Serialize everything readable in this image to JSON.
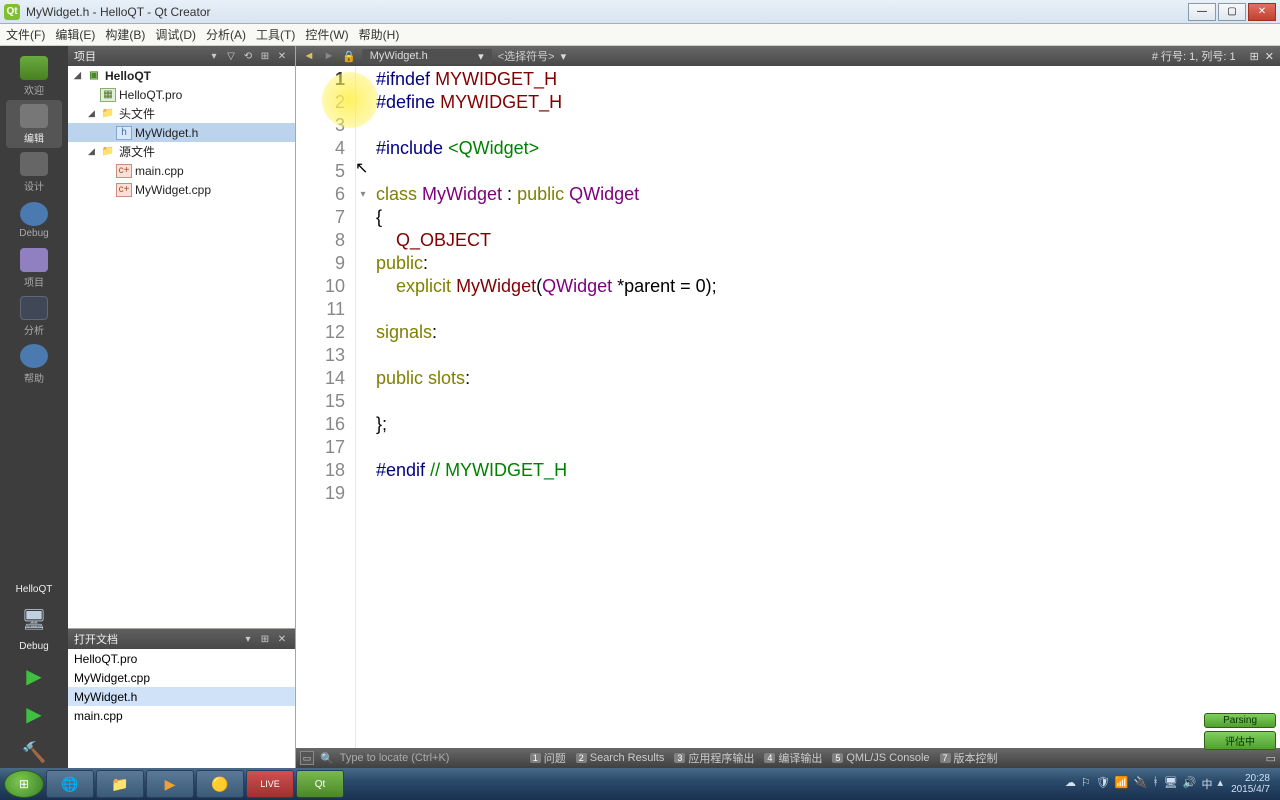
{
  "window": {
    "title": "MyWidget.h - HelloQT - Qt Creator"
  },
  "menubar": [
    "文件(F)",
    "编辑(E)",
    "构建(B)",
    "调试(D)",
    "分析(A)",
    "工具(T)",
    "控件(W)",
    "帮助(H)"
  ],
  "modes": {
    "items": [
      {
        "label": "欢迎"
      },
      {
        "label": "编辑"
      },
      {
        "label": "设计"
      },
      {
        "label": "Debug"
      },
      {
        "label": "项目"
      },
      {
        "label": "分析"
      },
      {
        "label": "帮助"
      }
    ],
    "active_index": 1,
    "kit_label": "HelloQT",
    "debug_label": "Debug"
  },
  "projects_panel": {
    "title": "项目",
    "tree": [
      {
        "label": "HelloQT",
        "kind": "project",
        "bold": true,
        "indent": 0,
        "expanded": true
      },
      {
        "label": "HelloQT.pro",
        "kind": "pro",
        "indent": 1
      },
      {
        "label": "头文件",
        "kind": "folder",
        "indent": 1,
        "expanded": true
      },
      {
        "label": "MyWidget.h",
        "kind": "h",
        "indent": 2,
        "selected": true
      },
      {
        "label": "源文件",
        "kind": "folder",
        "indent": 1,
        "expanded": true
      },
      {
        "label": "main.cpp",
        "kind": "cpp",
        "indent": 2
      },
      {
        "label": "MyWidget.cpp",
        "kind": "cpp",
        "indent": 2
      }
    ]
  },
  "open_docs_panel": {
    "title": "打开文档",
    "docs": [
      {
        "label": "HelloQT.pro"
      },
      {
        "label": "MyWidget.cpp"
      },
      {
        "label": "MyWidget.h",
        "selected": true
      },
      {
        "label": "main.cpp"
      }
    ]
  },
  "editor_toolbar": {
    "file": "MyWidget.h",
    "symbol": "<选择符号>",
    "position": "#   行号: 1, 列号: 1"
  },
  "code": {
    "lines": [
      {
        "n": 1,
        "seg": [
          [
            "pp",
            "#ifndef"
          ],
          [
            "op",
            " "
          ],
          [
            "ident",
            "MYWIDGET_H"
          ]
        ]
      },
      {
        "n": 2,
        "seg": [
          [
            "pp",
            "#define"
          ],
          [
            "op",
            " "
          ],
          [
            "ident",
            "MYWIDGET_H"
          ]
        ]
      },
      {
        "n": 3,
        "seg": []
      },
      {
        "n": 4,
        "seg": [
          [
            "pp",
            "#include"
          ],
          [
            "op",
            " "
          ],
          [
            "str",
            "<QWidget>"
          ]
        ]
      },
      {
        "n": 5,
        "seg": []
      },
      {
        "n": 6,
        "fold": "▾",
        "seg": [
          [
            "kw",
            "class"
          ],
          [
            "op",
            " "
          ],
          [
            "type",
            "MyWidget"
          ],
          [
            "op",
            " : "
          ],
          [
            "kw",
            "public"
          ],
          [
            "op",
            " "
          ],
          [
            "type",
            "QWidget"
          ]
        ]
      },
      {
        "n": 7,
        "seg": [
          [
            "op",
            "{"
          ]
        ]
      },
      {
        "n": 8,
        "seg": [
          [
            "op",
            "    "
          ],
          [
            "ident",
            "Q_OBJECT"
          ]
        ]
      },
      {
        "n": 9,
        "seg": [
          [
            "kw",
            "public"
          ],
          [
            "op",
            ":"
          ]
        ]
      },
      {
        "n": 10,
        "seg": [
          [
            "op",
            "    "
          ],
          [
            "kw",
            "explicit"
          ],
          [
            "op",
            " "
          ],
          [
            "ident",
            "MyWidget"
          ],
          [
            "op",
            "("
          ],
          [
            "type",
            "QWidget"
          ],
          [
            "op",
            " *parent = 0);"
          ]
        ]
      },
      {
        "n": 11,
        "seg": []
      },
      {
        "n": 12,
        "seg": [
          [
            "kw",
            "signals"
          ],
          [
            "op",
            ":"
          ]
        ]
      },
      {
        "n": 13,
        "seg": []
      },
      {
        "n": 14,
        "seg": [
          [
            "kw",
            "public"
          ],
          [
            "op",
            " "
          ],
          [
            "kw",
            "slots"
          ],
          [
            "op",
            ":"
          ]
        ]
      },
      {
        "n": 15,
        "seg": []
      },
      {
        "n": 16,
        "seg": [
          [
            "op",
            "};"
          ]
        ]
      },
      {
        "n": 17,
        "seg": []
      },
      {
        "n": 18,
        "seg": [
          [
            "pp",
            "#endif"
          ],
          [
            "op",
            " "
          ],
          [
            "comment",
            "// MYWIDGET_H"
          ]
        ]
      },
      {
        "n": 19,
        "seg": []
      }
    ],
    "current_line": 1
  },
  "locator": {
    "placeholder": "Type to locate (Ctrl+K)",
    "tabs": [
      {
        "n": "1",
        "label": "问题"
      },
      {
        "n": "2",
        "label": "Search Results"
      },
      {
        "n": "3",
        "label": "应用程序输出"
      },
      {
        "n": "4",
        "label": "编译输出"
      },
      {
        "n": "5",
        "label": "QML/JS Console"
      },
      {
        "n": "7",
        "label": "版本控制"
      }
    ]
  },
  "status_boxes": [
    "Parsing",
    "评估中"
  ],
  "taskbar": {
    "clock_time": "20:28",
    "clock_date": "2015/4/7"
  }
}
